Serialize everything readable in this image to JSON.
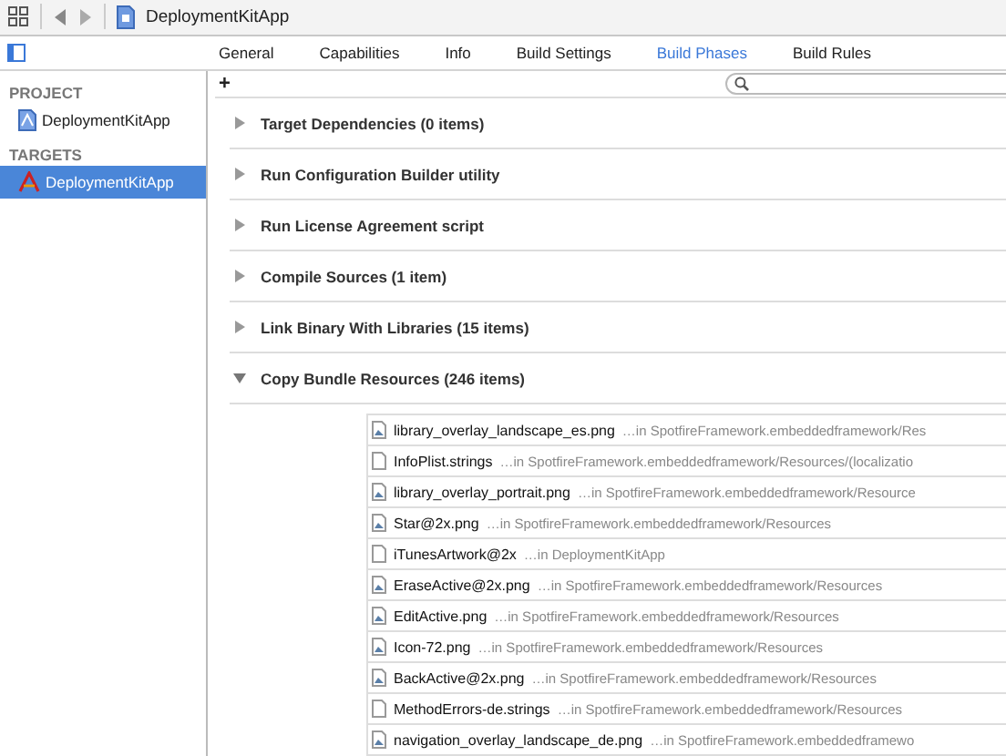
{
  "toolbar": {
    "file_title": "DeploymentKitApp"
  },
  "tabs": [
    {
      "label": "General",
      "selected": false
    },
    {
      "label": "Capabilities",
      "selected": false
    },
    {
      "label": "Info",
      "selected": false
    },
    {
      "label": "Build Settings",
      "selected": false
    },
    {
      "label": "Build Phases",
      "selected": true
    },
    {
      "label": "Build Rules",
      "selected": false
    }
  ],
  "add_button": "+",
  "sidebar": {
    "sections": [
      {
        "heading": "PROJECT",
        "items": [
          {
            "label": "DeploymentKitApp",
            "kind": "project",
            "selected": false
          }
        ]
      },
      {
        "heading": "TARGETS",
        "items": [
          {
            "label": "DeploymentKitApp",
            "kind": "target",
            "selected": true
          }
        ]
      }
    ]
  },
  "phases": [
    {
      "label": "Target Dependencies (0 items)",
      "expanded": false
    },
    {
      "label": "Run Configuration Builder utility",
      "expanded": false
    },
    {
      "label": "Run License Agreement script",
      "expanded": false
    },
    {
      "label": "Compile Sources (1 item)",
      "expanded": false
    },
    {
      "label": "Link Binary With Libraries (15 items)",
      "expanded": false
    },
    {
      "label": "Copy Bundle Resources (246 items)",
      "expanded": true
    }
  ],
  "files": [
    {
      "name": "library_overlay_landscape_es.png",
      "location": "…in SpotfireFramework.embeddedframework/Res",
      "kind": "image"
    },
    {
      "name": "InfoPlist.strings",
      "location": "…in SpotfireFramework.embeddedframework/Resources/(localizatio",
      "kind": "document"
    },
    {
      "name": "library_overlay_portrait.png",
      "location": "…in SpotfireFramework.embeddedframework/Resource",
      "kind": "image"
    },
    {
      "name": "Star@2x.png",
      "location": "…in SpotfireFramework.embeddedframework/Resources",
      "kind": "image"
    },
    {
      "name": "iTunesArtwork@2x",
      "location": "…in DeploymentKitApp",
      "kind": "document"
    },
    {
      "name": "EraseActive@2x.png",
      "location": "…in SpotfireFramework.embeddedframework/Resources",
      "kind": "image"
    },
    {
      "name": "EditActive.png",
      "location": "…in SpotfireFramework.embeddedframework/Resources",
      "kind": "image"
    },
    {
      "name": "Icon-72.png",
      "location": "…in SpotfireFramework.embeddedframework/Resources",
      "kind": "image"
    },
    {
      "name": "BackActive@2x.png",
      "location": "…in SpotfireFramework.embeddedframework/Resources",
      "kind": "image"
    },
    {
      "name": "MethodErrors-de.strings",
      "location": "…in SpotfireFramework.embeddedframework/Resources",
      "kind": "document"
    },
    {
      "name": "navigation_overlay_landscape_de.png",
      "location": "…in SpotfireFramework.embeddedframewo",
      "kind": "image"
    }
  ]
}
